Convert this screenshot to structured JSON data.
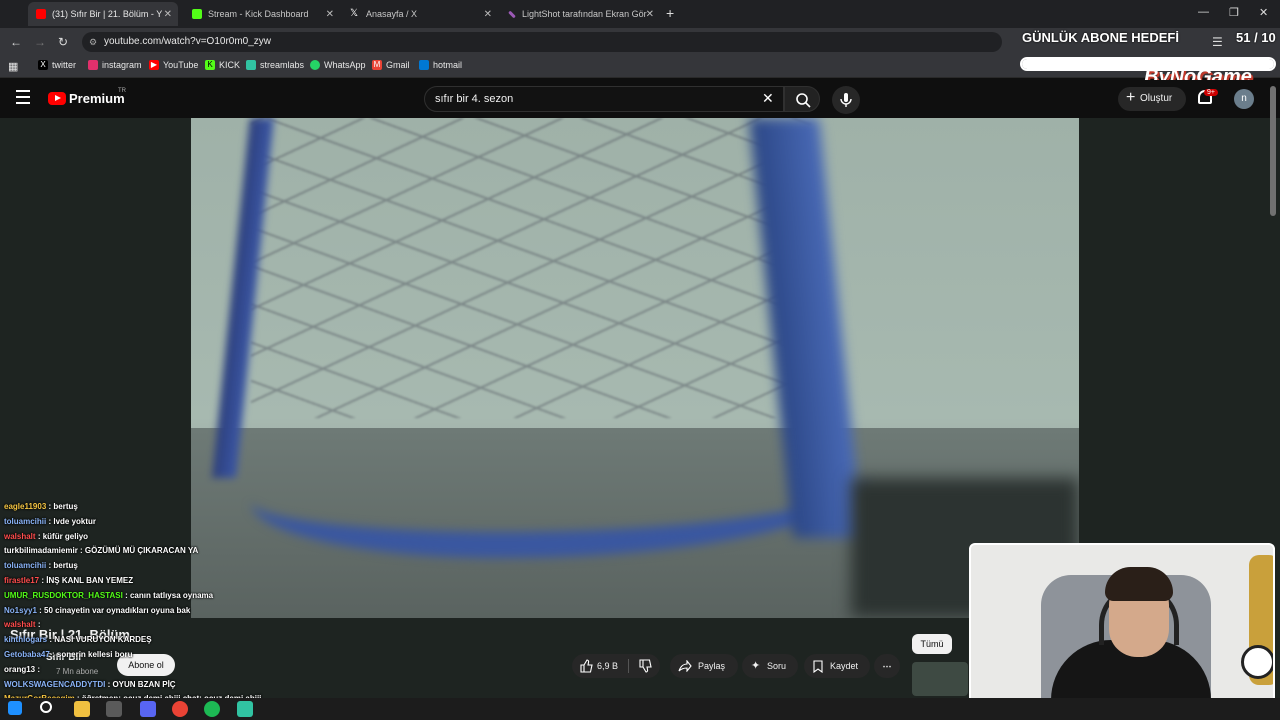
{
  "browser": {
    "tabs": [
      {
        "label": "(31) Sıfır Bir | 21. Bölüm - Y",
        "color": "#ff0000",
        "active": true
      },
      {
        "label": "Stream - Kick Dashboard",
        "color": "#53fc18"
      },
      {
        "label": "Anasayfa / X",
        "color": "#ffffff"
      },
      {
        "label": "LightShot tarafından Ekran Gör",
        "color": "#9b59b6"
      }
    ],
    "url": "youtube.com/watch?v=O10r0m0_zyw",
    "bookmarks": [
      {
        "label": "twitter",
        "icon": "x-icon",
        "color": "#000000"
      },
      {
        "label": "instagram",
        "icon": "instagram-icon",
        "color": "#e1306c"
      },
      {
        "label": "YouTube",
        "icon": "youtube-icon",
        "color": "#ff0000"
      },
      {
        "label": "KICK",
        "icon": "kick-icon",
        "color": "#53fc18"
      },
      {
        "label": "streamlabs",
        "icon": "streamlabs-icon",
        "color": "#31c3a2"
      },
      {
        "label": "WhatsApp",
        "icon": "whatsapp-icon",
        "color": "#25d366"
      },
      {
        "label": "Gmail",
        "icon": "gmail-icon",
        "color": "#ea4335"
      },
      {
        "label": "hotmail",
        "icon": "outlook-icon",
        "color": "#0078d4"
      }
    ]
  },
  "overlay": {
    "goal_title": "GÜNLÜK ABONE HEDEFİ",
    "goal_count": "51 / 10",
    "goal_progress": 1.0,
    "brand": "ByNoGame"
  },
  "youtube": {
    "brand": "Premium",
    "region": "TR",
    "search_value": "sıfır bir 4. sezon",
    "create_label": "Oluştur",
    "notif_badge": "9+",
    "avatar_letter": "n",
    "video_title": "Sıfır Bir | 21. Bölüm",
    "channel_name": "Sıfır Bir",
    "channel_subs": "7 Mn abone",
    "subscribe_label": "Abone ol",
    "like_count": "6,9 B",
    "share_label": "Paylaş",
    "ask_label": "Soru",
    "save_label": "Kaydet",
    "chip_all": "Tümü"
  },
  "chat": [
    {
      "user": "eagle11903",
      "text": ": bertuş",
      "color": "#f5c542"
    },
    {
      "user": "toluamcihii",
      "text": ": lvde yoktur",
      "color": "#8ab4f8"
    },
    {
      "user": "walshalt",
      "text": ": küfür geliyo",
      "color": "#ff4d4d"
    },
    {
      "user": "turkbilimadamiemir",
      "text": ": GÖZÜMÜ MÜ ÇIKARACAN YA",
      "color": "#ffffff"
    },
    {
      "user": "toluamcihii",
      "text": ": bertuş",
      "color": "#8ab4f8"
    },
    {
      "user": "firastle17",
      "text": ": İNŞ KANL BAN YEMEZ",
      "color": "#ff4d4d"
    },
    {
      "user": "UMUR_RUSDOKTOR_HASTASI",
      "text": ": canın tatlıysa oynama",
      "color": "#53fc18"
    },
    {
      "user": "No1syy1",
      "text": ": 50 cinayetin var oynadıkları oyuna bak",
      "color": "#8ab4f8"
    },
    {
      "user": "walshalt",
      "text": ":",
      "color": "#ff4d4d"
    },
    {
      "user": "kinthlogars",
      "text": ": NASI VURUYON KARDEŞ",
      "color": "#8ab4f8"
    },
    {
      "user": "Getobaba47",
      "text": ": sonerin kellesi boru",
      "color": "#8ab4f8"
    },
    {
      "user": "orang13",
      "text": ":",
      "color": "#ffffff"
    },
    {
      "user": "WOLKSWAGENCADDYTDI",
      "text": ": OYUN BZAN PİÇ",
      "color": "#8ab4f8"
    },
    {
      "user": "MazurGorBecegim",
      "text": ": öğretmen: ocuz demi abiii chat: ocuz demi abiii",
      "color": "#f5c542"
    }
  ]
}
